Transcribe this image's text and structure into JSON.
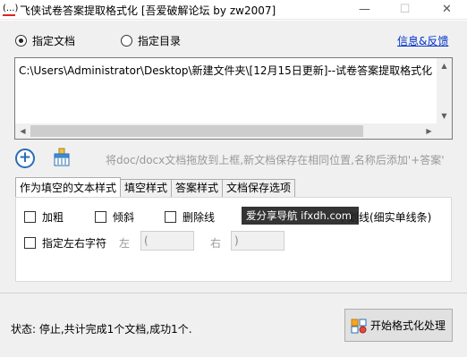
{
  "window": {
    "title": "飞侠试卷答案提取格式化 [吾爱破解论坛 by zw2007]",
    "icon_glyph": "(...)",
    "minimize": "—",
    "maximize": "☐",
    "close": "✕"
  },
  "source": {
    "options": [
      {
        "label": "指定文档",
        "checked": true
      },
      {
        "label": "指定目录",
        "checked": false
      }
    ],
    "info_link": "信息&反馈"
  },
  "path_list": {
    "value": "C:\\Users\\Administrator\\Desktop\\新建文件夹\\[12月15日更新]--试卷答案提取格式化",
    "scroll_up": "▲",
    "scroll_down": "▼",
    "scroll_left": "◀",
    "scroll_right": "▶"
  },
  "toolbar": {
    "add_icon": "plus-circle-icon",
    "add_glyph": "+",
    "clear_icon": "broom-clear-icon",
    "hint": "将doc/docx文档拖放到上框,新文档保存在相同位置,名称后添加'+答案'"
  },
  "tabs": [
    {
      "label": "作为填空的文本样式",
      "active": true
    },
    {
      "label": "填空样式",
      "active": false
    },
    {
      "label": "答案样式",
      "active": false
    },
    {
      "label": "文档保存选项",
      "active": false
    }
  ],
  "text_style": {
    "bold": "加粗",
    "italic": "倾斜",
    "strike": "删除线",
    "underline": "下划线(细实单线条)",
    "left_right_chars": "指定左右字符",
    "left_label": "左",
    "left_value": "(",
    "right_label": "右",
    "right_value": ")"
  },
  "watermark": "爱分享导航 ifxdh.com",
  "status": "状态: 停止,共计完成1个文档,成功1个.",
  "start_button": "开始格式化处理",
  "colors": {
    "accent_link": "#0033cc",
    "icon_blue": "#2a6db5",
    "window_bg": "#f0f0f0"
  }
}
